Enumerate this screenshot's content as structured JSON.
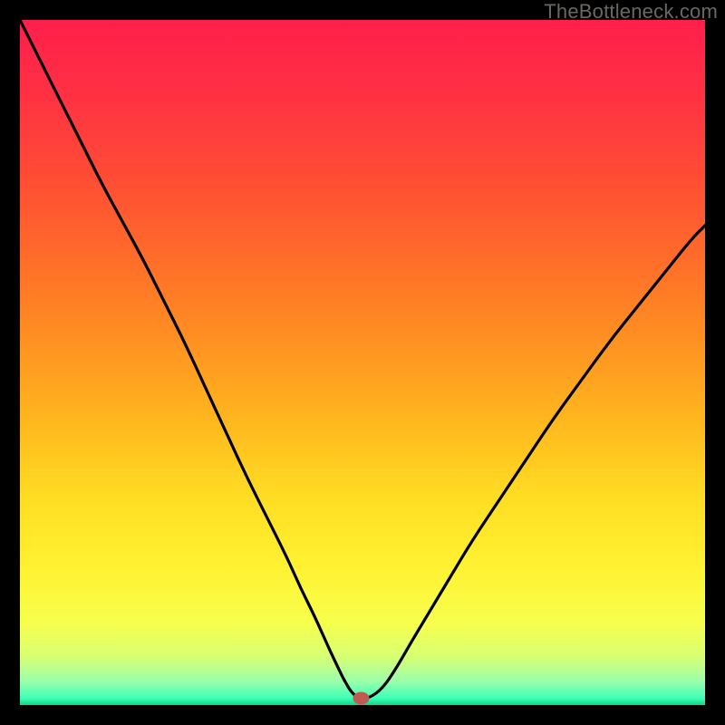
{
  "watermark": "TheBottleneck.com",
  "chart_data": {
    "type": "line",
    "title": "",
    "xlabel": "",
    "ylabel": "",
    "xlim": [
      0,
      100
    ],
    "ylim": [
      0,
      100
    ],
    "background": "rainbow-vertical",
    "curve": {
      "name": "bottleneck-curve",
      "x": [
        0,
        3,
        6,
        9,
        12,
        15,
        18,
        21,
        24,
        27,
        30,
        33,
        36,
        39,
        41,
        43,
        45,
        46.5,
        47.5,
        48.5,
        49.5,
        51,
        53,
        55,
        57,
        60,
        63,
        66,
        70,
        74,
        78,
        82,
        86,
        90,
        94,
        98,
        100
      ],
      "y": [
        100,
        94,
        88,
        82,
        76,
        70.5,
        65,
        59,
        53,
        46.5,
        40,
        33.5,
        27.5,
        21.5,
        17,
        13,
        8.5,
        5.3,
        3.3,
        1.7,
        1.0,
        1.0,
        2.5,
        5.5,
        9,
        14,
        19,
        24,
        30,
        36,
        42,
        47.5,
        53,
        58,
        63,
        68,
        70
      ]
    },
    "marker": {
      "x": 49.8,
      "y": 1.0,
      "color": "#c05a52"
    },
    "green_band": {
      "y_min": 0,
      "y_max": 4.0
    },
    "gradient_stops": [
      {
        "offset": 0.0,
        "color": "#ff1f4b"
      },
      {
        "offset": 0.1,
        "color": "#ff2f44"
      },
      {
        "offset": 0.22,
        "color": "#ff4a36"
      },
      {
        "offset": 0.34,
        "color": "#ff6a2a"
      },
      {
        "offset": 0.46,
        "color": "#ff8e22"
      },
      {
        "offset": 0.58,
        "color": "#ffb51e"
      },
      {
        "offset": 0.7,
        "color": "#ffde23"
      },
      {
        "offset": 0.8,
        "color": "#fff232"
      },
      {
        "offset": 0.88,
        "color": "#f7ff4d"
      },
      {
        "offset": 0.93,
        "color": "#d6ff74"
      },
      {
        "offset": 0.965,
        "color": "#9cffab"
      },
      {
        "offset": 0.99,
        "color": "#3fffb7"
      },
      {
        "offset": 1.0,
        "color": "#0cd981"
      }
    ]
  }
}
